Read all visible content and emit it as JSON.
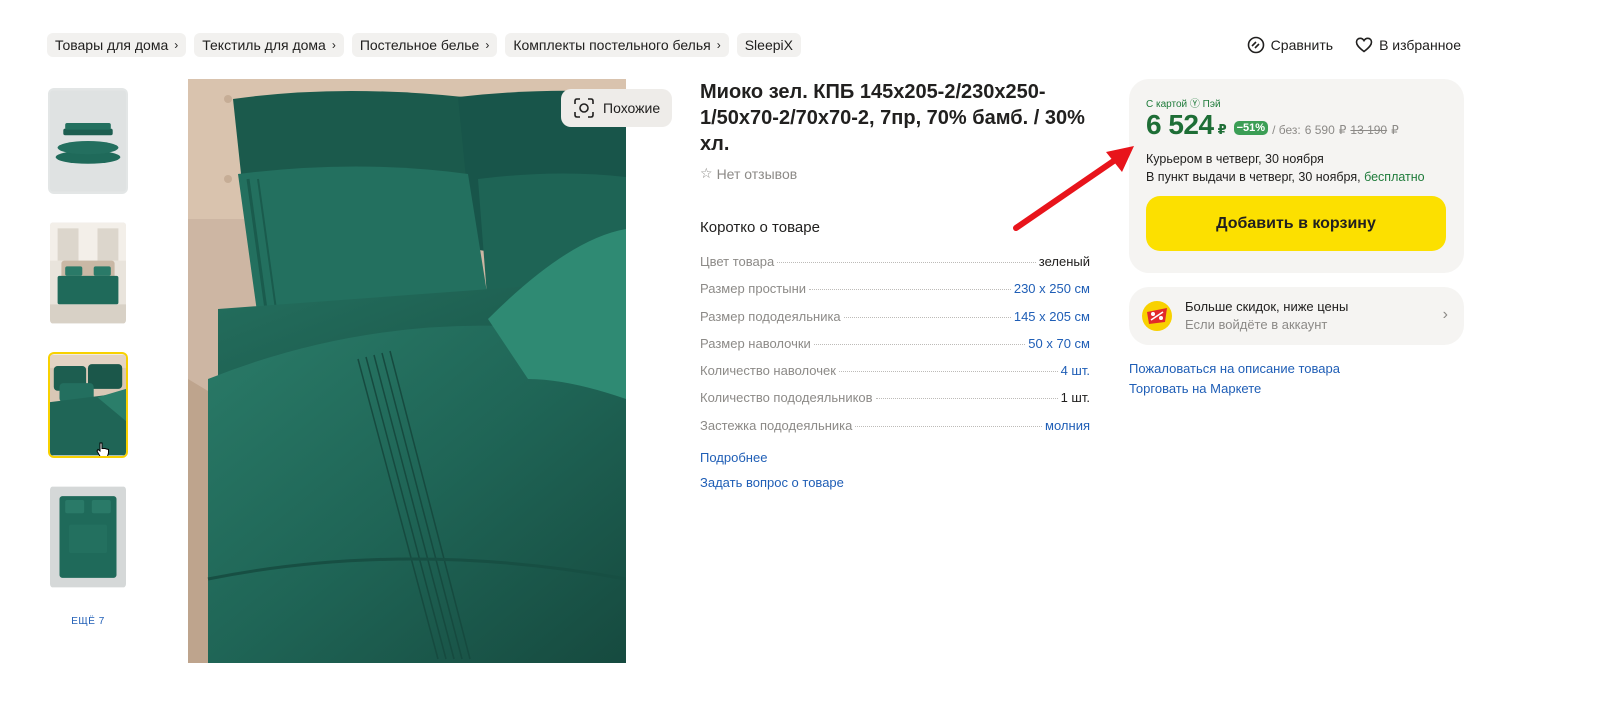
{
  "breadcrumbs": [
    {
      "label": "Товары для дома",
      "chevron": true
    },
    {
      "label": "Текстиль для дома",
      "chevron": true
    },
    {
      "label": "Постельное белье",
      "chevron": true
    },
    {
      "label": "Комплекты постельного белья",
      "chevron": true
    },
    {
      "label": "SleepiX",
      "chevron": false
    }
  ],
  "actions": {
    "compare": "Сравнить",
    "favorite": "В избранное"
  },
  "gallery": {
    "more": "ЕЩЁ 7",
    "similar": "Похожие",
    "active_thumb": 3
  },
  "product": {
    "title": "Миоко зел. КПБ 145х205-2/230х250-1/50х70-2/70х70-2, 7пр, 70% бамб. / 30% хл.",
    "reviews": "Нет отзывов",
    "brief_title": "Коротко о товаре",
    "specs": [
      {
        "name": "Цвет товара",
        "value": "зеленый",
        "link": false
      },
      {
        "name": "Размер простыни",
        "value": "230 x 250 см",
        "link": true
      },
      {
        "name": "Размер пододеяльника",
        "value": "145 x 205 см",
        "link": true
      },
      {
        "name": "Размер наволочки",
        "value": "50 x 70 см",
        "link": true
      },
      {
        "name": "Количество наволочек",
        "value": "4 шт.",
        "link": true
      },
      {
        "name": "Количество пододеяльников",
        "value": "1 шт.",
        "link": false
      },
      {
        "name": "Застежка пододеяльника",
        "value": "молния",
        "link": true
      }
    ],
    "more_link": "Подробнее",
    "ask_link": "Задать вопрос о товаре"
  },
  "price_card": {
    "label": "С картой Ⓨ Пэй",
    "price": "6 524",
    "currency": "₽",
    "discount": "−51%",
    "without_prefix": "/ без:",
    "without_price": "6 590",
    "old_price": "13 190",
    "delivery_courier": "Курьером в четверг, 30 ноября",
    "delivery_pickup": "В пункт выдачи в четверг, 30 ноября,",
    "delivery_free": "бесплатно",
    "add_to_cart": "Добавить в корзину"
  },
  "promo": {
    "title": "Больше скидок, ниже цены",
    "subtitle": "Если войдёте в аккаунт"
  },
  "side_links": {
    "complain": "Пожаловаться на описание товара",
    "sell": "Торговать на Маркете"
  },
  "colors": {
    "accent_yellow": "#fce000",
    "price_green": "#1e6e36",
    "link_blue": "#1f5eb6",
    "bedding_green": "#1d5e50",
    "arrow_red": "#e8141b"
  }
}
